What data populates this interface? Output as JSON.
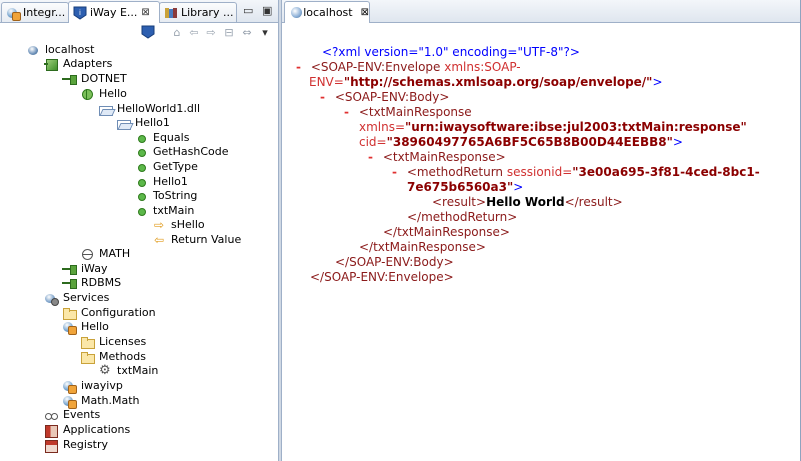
{
  "left_tabs": [
    {
      "label": "Integr..."
    },
    {
      "label": "iWay E...",
      "close": "⊠"
    },
    {
      "label": "Library ..."
    }
  ],
  "tree": {
    "root": "localhost",
    "adapters": "Adapters",
    "dotnet": "DOTNET",
    "hello": "Hello",
    "dll": "HelloWorld1.dll",
    "hello1": "Hello1",
    "methods": [
      "Equals",
      "GetHashCode",
      "GetType",
      "Hello1",
      "ToString",
      "txtMain"
    ],
    "shello": "sHello",
    "return_value": "Return Value",
    "math": "MATH",
    "iway": "iWay",
    "rdbms": "RDBMS",
    "services": "Services",
    "configuration": "Configuration",
    "svc_hello": "Hello",
    "licenses": "Licenses",
    "svc_methods": "Methods",
    "svc_txtmain": "txtMain",
    "iwayivp": "iwayivp",
    "mathmath": "Math.Math",
    "events": "Events",
    "applications": "Applications",
    "registry": "Registry"
  },
  "editor": {
    "tab_label": "localhost",
    "tab_close": "⊠",
    "xml": {
      "decl": "<?xml version=\"1.0\" encoding=\"UTF-8\"?>",
      "minus": "-",
      "envelope_open": "<SOAP-ENV:Envelope",
      "xmlns_attr": "xmlns:SOAP-",
      "env_attr": "ENV=",
      "env_value": "\"http://schemas.xmlsoap.org/soap/envelope/\"",
      "gt": ">",
      "body_open": "<SOAP-ENV:Body>",
      "resp_open": "<txtMainResponse",
      "xmlns_plain": "xmlns=",
      "xmlns_value": "\"urn:iwaysoftware:ibse:jul2003:txtMain:response\"",
      "cid_attr": "cid=",
      "cid_value": "\"38960497765A6BF5C65B8B00D44EEBB8\"",
      "inner_resp_open": "<txtMainResponse>",
      "method_open": "<methodReturn",
      "session_attr": "sessionid=",
      "session_value_1": "\"3e00a695-3f81-4ced-8bc1-",
      "session_value_2": "7e675b6560a3\"",
      "result_open": "<result>",
      "result_text": "Hello World",
      "result_close": "</result>",
      "method_close": "</methodReturn>",
      "inner_resp_close": "</txtMainResponse>",
      "resp_close": "</txtMainResponse>",
      "body_close": "</SOAP-ENV:Body>",
      "envelope_close": "</SOAP-ENV:Envelope>"
    }
  }
}
